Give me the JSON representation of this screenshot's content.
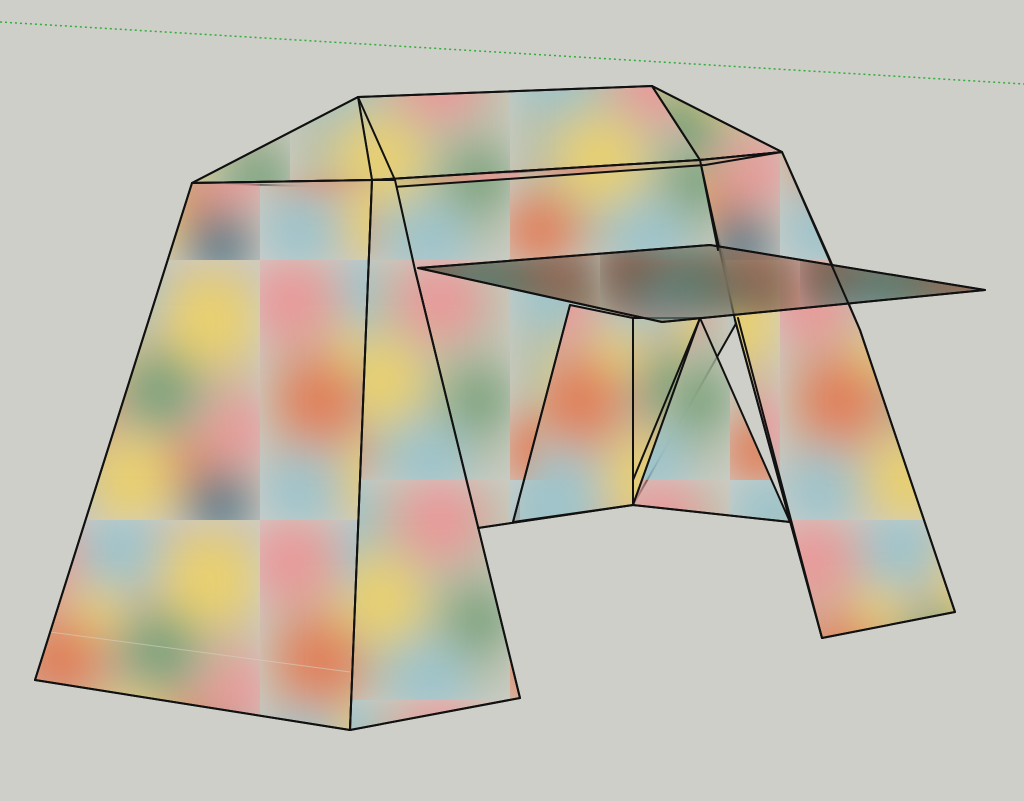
{
  "scene": {
    "background_color": "#cfcfca",
    "axis_color": "#2fae3a",
    "edge_color": "#111111",
    "material": "multicolor-blurred-texture",
    "texture_palette": [
      "#e89a9a",
      "#e8d070",
      "#9cc4cc",
      "#e0805a",
      "#7aa27a",
      "#5a7a88"
    ],
    "tabletop_palette": [
      "#7a5a48",
      "#5a7a6a",
      "#9a6a58",
      "#6a8a88",
      "#8a6a50"
    ]
  }
}
